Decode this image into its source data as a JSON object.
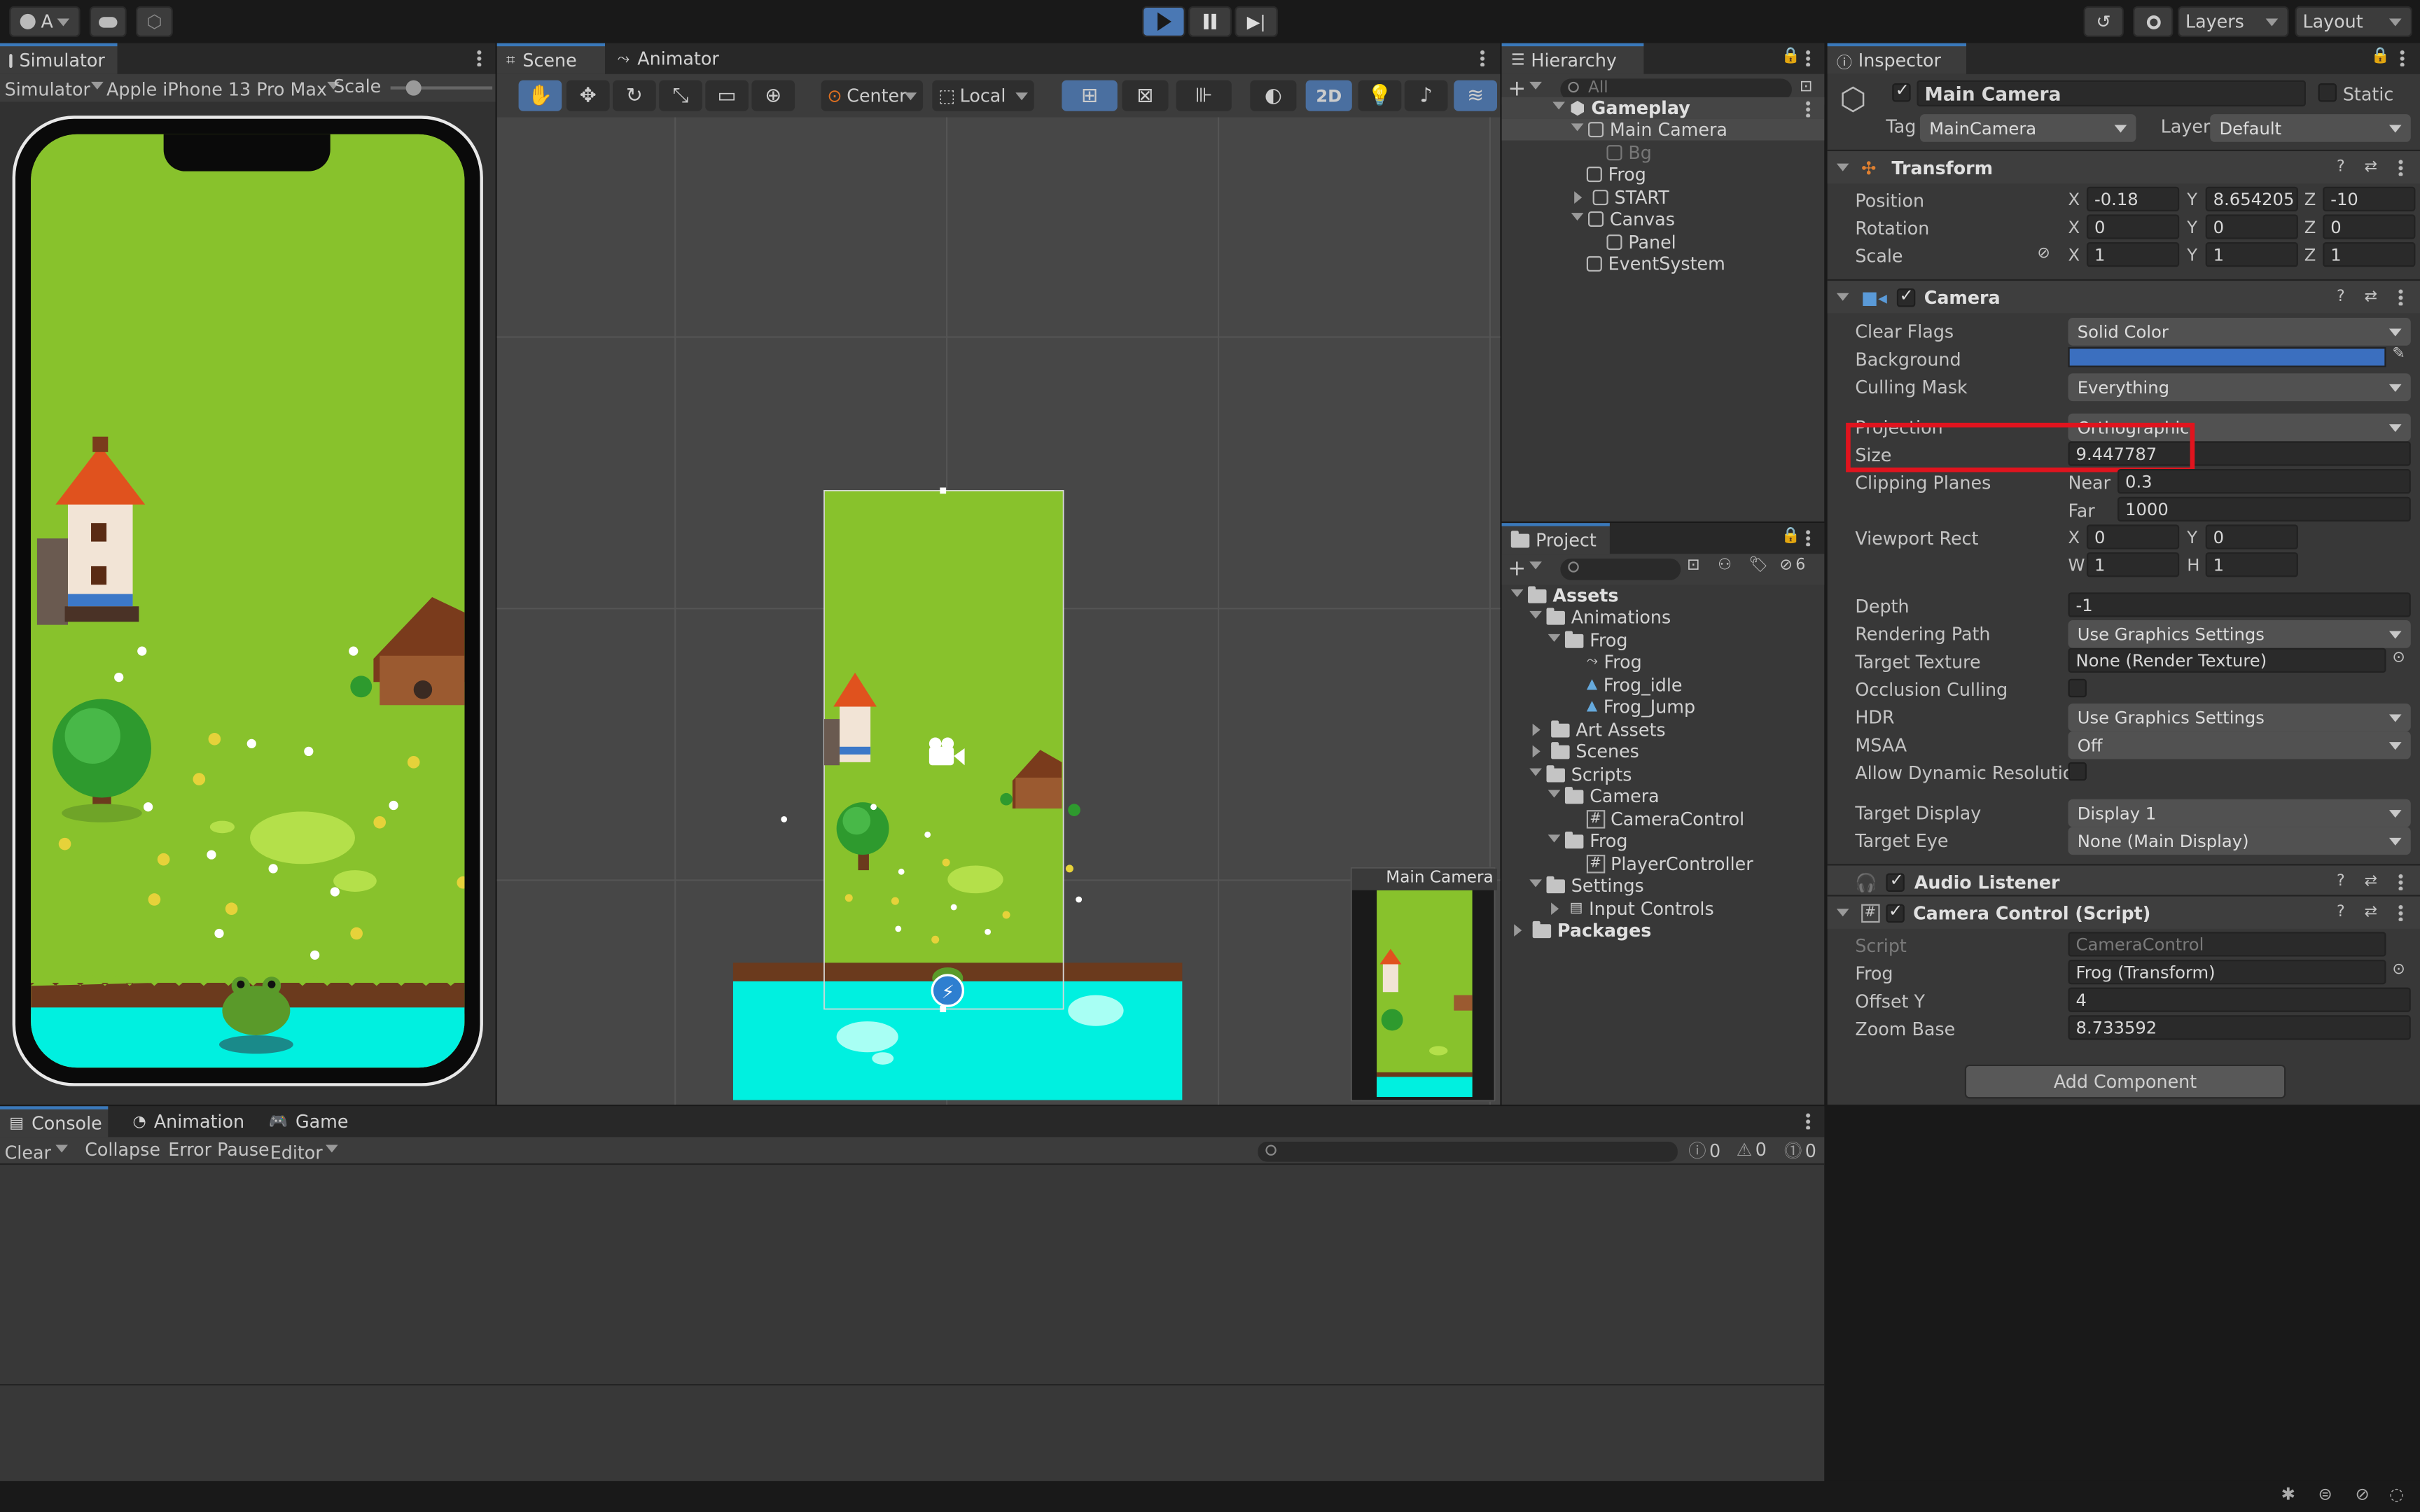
{
  "toolbar": {
    "account": "A",
    "layers": "Layers",
    "layout": "Layout"
  },
  "simulator": {
    "tab": "Simulator",
    "mode": "Simulator",
    "device": "Apple iPhone 13 Pro Max",
    "scale_label": "Scale"
  },
  "scene": {
    "tabs": [
      "Scene",
      "Animator"
    ],
    "pivot": "Center",
    "space": "Local",
    "mode_2d": "2D",
    "cam_preview": "Main Camera"
  },
  "hierarchy": {
    "tab": "Hierarchy",
    "search": "All",
    "items": [
      "Gameplay",
      "Main Camera",
      "Bg",
      "Frog",
      "START",
      "Canvas",
      "Panel",
      "EventSystem"
    ]
  },
  "project": {
    "tab": "Project",
    "hidden_count": "6",
    "items": [
      "Assets",
      "Animations",
      "Frog",
      "Frog",
      "Frog_idle",
      "Frog_Jump",
      "Art Assets",
      "Scenes",
      "Scripts",
      "Camera",
      "CameraControl",
      "Frog",
      "PlayerController",
      "Settings",
      "Input Controls",
      "Packages"
    ]
  },
  "inspector": {
    "tab": "Inspector",
    "name": "Main Camera",
    "static": "Static",
    "tag_label": "Tag",
    "tag": "MainCamera",
    "layer_label": "Layer",
    "layer": "Default",
    "transform": {
      "title": "Transform",
      "position": "Position",
      "rotation": "Rotation",
      "scale": "Scale",
      "px": "-0.18",
      "py": "8.654205",
      "pz": "-10",
      "rx": "0",
      "ry": "0",
      "rz": "0",
      "sx": "1",
      "sy": "1",
      "sz": "1"
    },
    "camera": {
      "title": "Camera",
      "clear_flags": "Clear Flags",
      "clear_flags_v": "Solid Color",
      "background": "Background",
      "culling": "Culling Mask",
      "culling_v": "Everything",
      "projection": "Projection",
      "projection_v": "Orthographic",
      "size": "Size",
      "size_v": "9.447787",
      "clipping": "Clipping Planes",
      "near": "Near",
      "near_v": "0.3",
      "far": "Far",
      "far_v": "1000",
      "viewport": "Viewport Rect",
      "vx": "0",
      "vy": "0",
      "vw": "1",
      "vh": "1",
      "depth": "Depth",
      "depth_v": "-1",
      "render": "Rendering Path",
      "render_v": "Use Graphics Settings",
      "target_tex": "Target Texture",
      "target_tex_v": "None (Render Texture)",
      "occlusion": "Occlusion Culling",
      "hdr": "HDR",
      "hdr_v": "Use Graphics Settings",
      "msaa": "MSAA",
      "msaa_v": "Off",
      "dyn": "Allow Dynamic Resolution",
      "display": "Target Display",
      "display_v": "Display 1",
      "eye": "Target Eye",
      "eye_v": "None (Main Display)",
      "bg_color": "#3b6fbf"
    },
    "audio": "Audio Listener",
    "camctl": {
      "title": "Camera Control (Script)",
      "script": "Script",
      "script_v": "CameraControl",
      "frog": "Frog",
      "frog_v": "Frog (Transform)",
      "offset": "Offset Y",
      "offset_v": "4",
      "zoom": "Zoom Base",
      "zoom_v": "8.733592"
    },
    "add_component": "Add Component"
  },
  "console": {
    "tabs": [
      "Console",
      "Animation",
      "Game"
    ],
    "clear": "Clear",
    "collapse": "Collapse",
    "error_pause": "Error Pause",
    "editor": "Editor",
    "log": "0",
    "warn": "0",
    "err": "0"
  },
  "colors": {
    "accent": "#3a79bb",
    "highlight": "#e0141e",
    "grass": "#88c22c",
    "water": "#00f0e0"
  }
}
